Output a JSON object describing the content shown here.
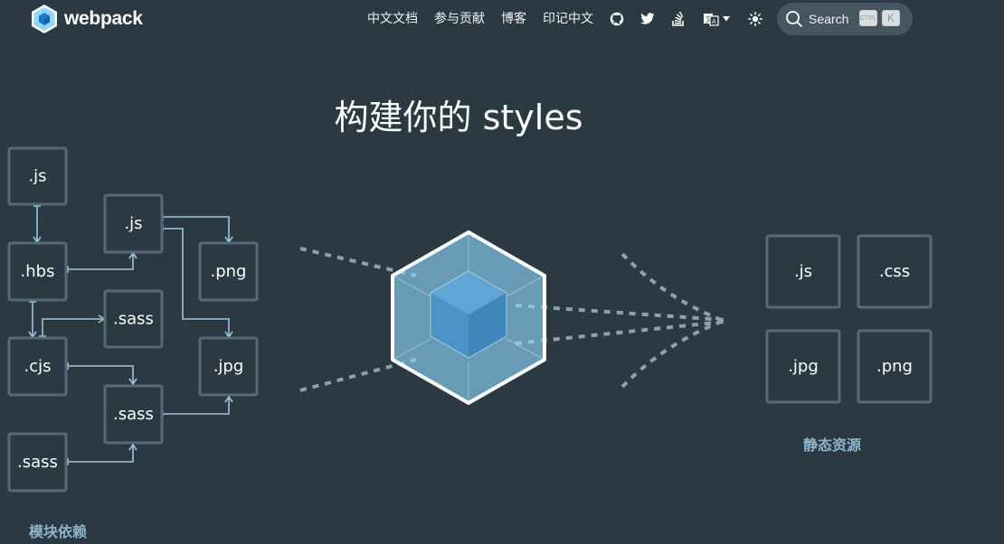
{
  "header": {
    "logo_text": "webpack",
    "nav": [
      {
        "label": "中文文档"
      },
      {
        "label": "参与贡献"
      },
      {
        "label": "博客"
      },
      {
        "label": "印记中文"
      }
    ],
    "icons": [
      "github-icon",
      "twitter-icon",
      "stack-overflow-icon",
      "language-icon",
      "chevron-down-icon",
      "theme-toggle-icon"
    ],
    "search": {
      "label": "Search",
      "shortcut_ctrl": "CTRL",
      "shortcut_key": "K"
    }
  },
  "hero": {
    "title": "构建你的 styles",
    "modules": [
      ".js",
      ".js",
      ".hbs",
      ".png",
      ".sass",
      ".cjs",
      ".jpg",
      ".sass",
      ".sass"
    ],
    "modules_caption": "模块依赖",
    "assets": [
      ".js",
      ".css",
      ".jpg",
      ".png"
    ],
    "assets_caption": "静态资源"
  },
  "colors": {
    "background": "#2b3a42",
    "node_border": "#536b79",
    "connector": "#9ec4da",
    "caption": "#8db4cc",
    "cube_outer": "#8ed6fb",
    "cube_inner": "#1c78c0"
  }
}
